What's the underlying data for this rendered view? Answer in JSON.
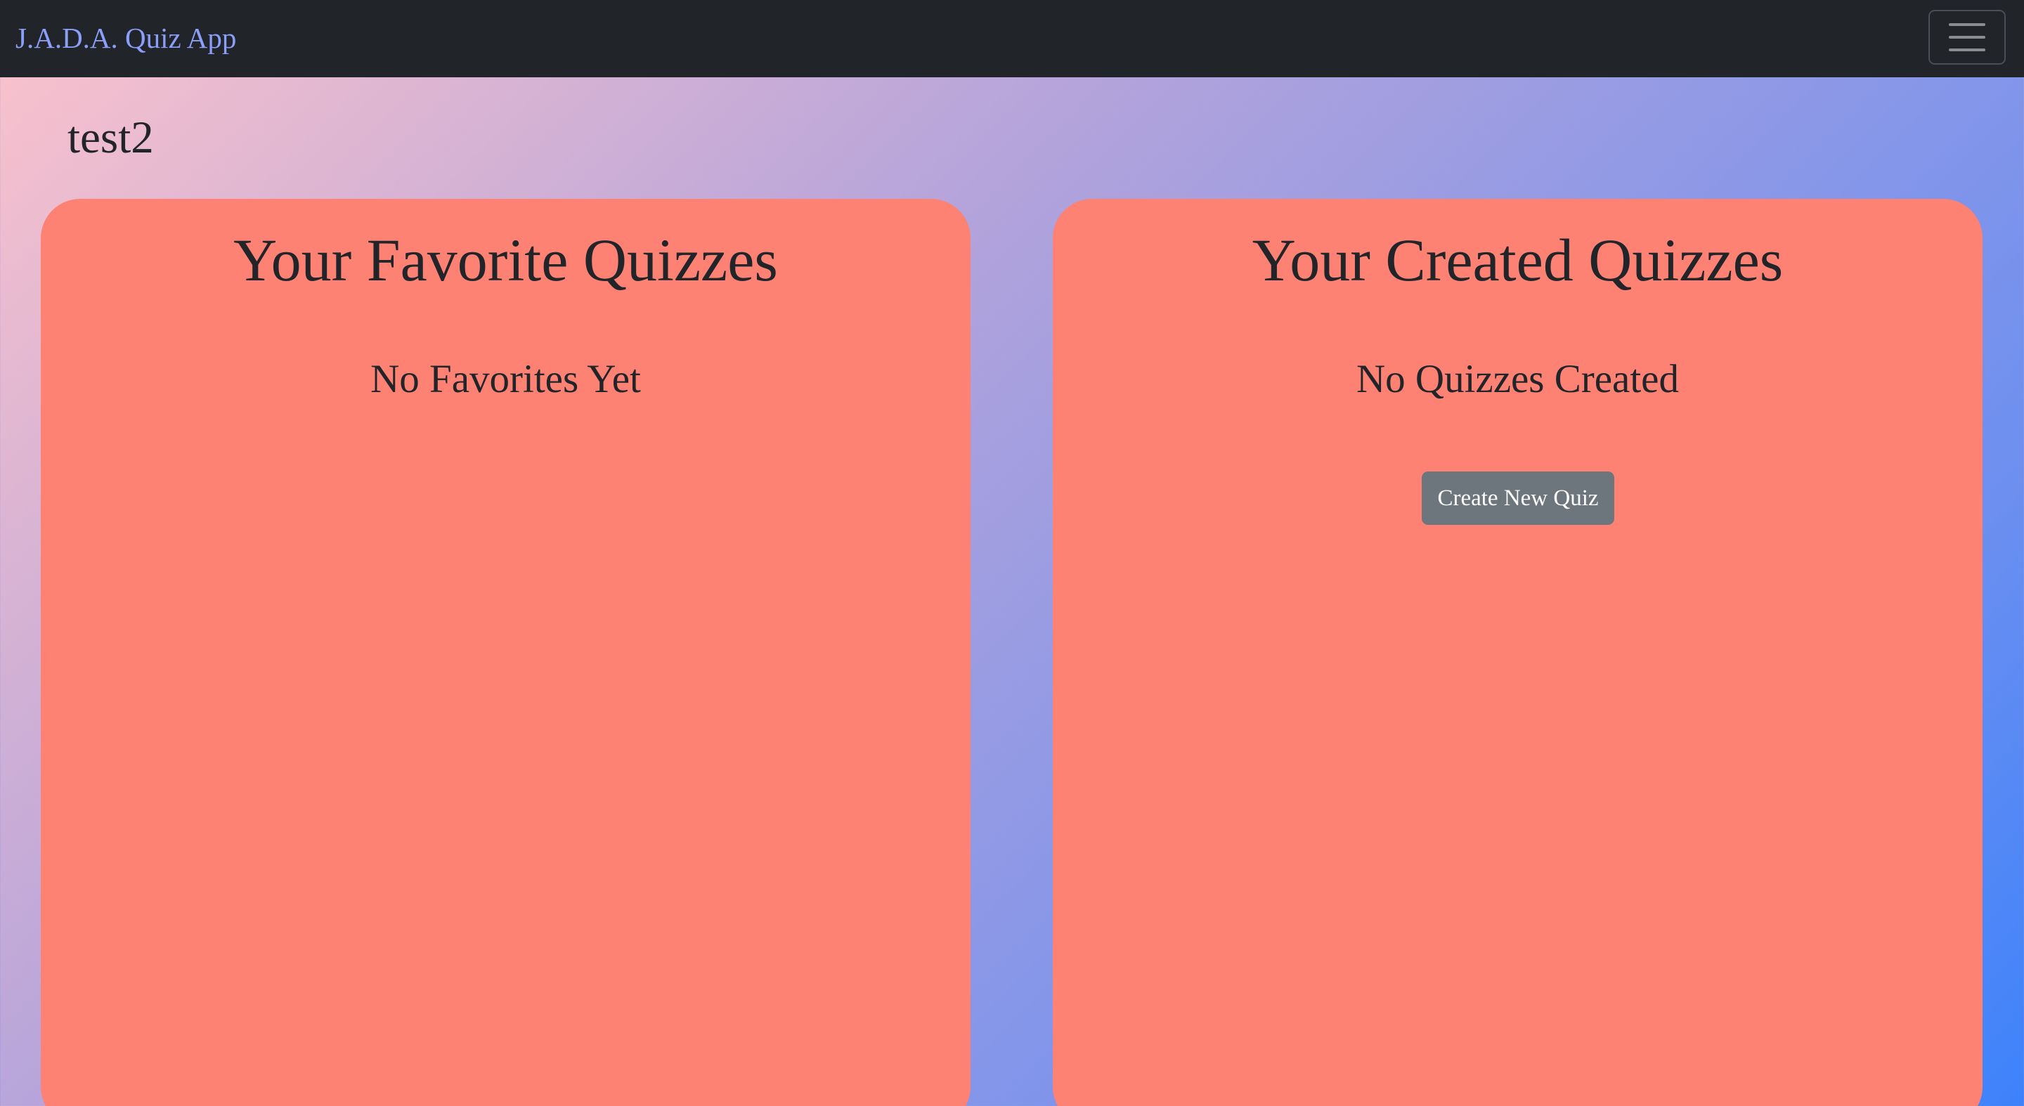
{
  "navbar": {
    "brand": "J.A.D.A. Quiz App",
    "toggler_icon": "hamburger-menu-icon"
  },
  "user": {
    "name": "test2"
  },
  "favorites": {
    "title": "Your Favorite Quizzes",
    "empty_text": "No Favorites Yet"
  },
  "created": {
    "title": "Your Created Quizzes",
    "empty_text": "No Quizzes Created",
    "create_button_label": "Create New Quiz"
  },
  "colors": {
    "navbar_bg": "#212429",
    "brand_text": "#8b9ef8",
    "panel_bg": "#fd8273",
    "button_bg": "#6d757d",
    "gradient_start": "#fcc3cc",
    "gradient_end": "#3d82fb"
  }
}
